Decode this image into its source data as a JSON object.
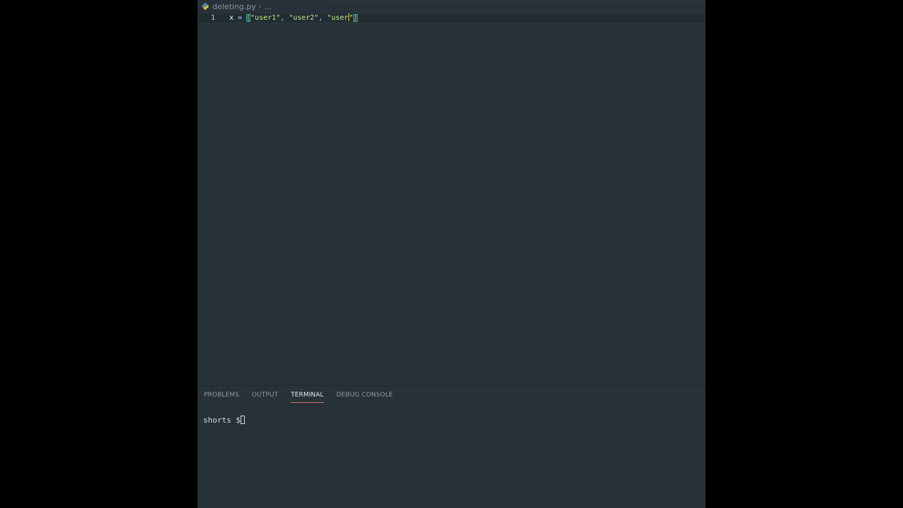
{
  "breadcrumb": {
    "file": "deleting.py",
    "more": "...",
    "icon": "python-file-icon"
  },
  "editor": {
    "line_number": "1",
    "code": {
      "var": "x",
      "op": "=",
      "open_bracket": "[",
      "str1": "\"user1\"",
      "comma1": ",",
      "str2": "\"user2\"",
      "comma2": ",",
      "str3_before_cursor": "\"user",
      "str3_after_cursor": "\"",
      "close_bracket": "]"
    }
  },
  "panel": {
    "tabs": [
      {
        "label": "PROBLEMS"
      },
      {
        "label": "OUTPUT"
      },
      {
        "label": "TERMINAL"
      },
      {
        "label": "DEBUG CONSOLE"
      }
    ],
    "active_tab": "TERMINAL",
    "terminal_prompt": "shorts $"
  },
  "colors": {
    "background": "#263238",
    "string": "#c3e88d",
    "operator": "#89ddff",
    "active_tab_underline": "#d66f6f"
  }
}
